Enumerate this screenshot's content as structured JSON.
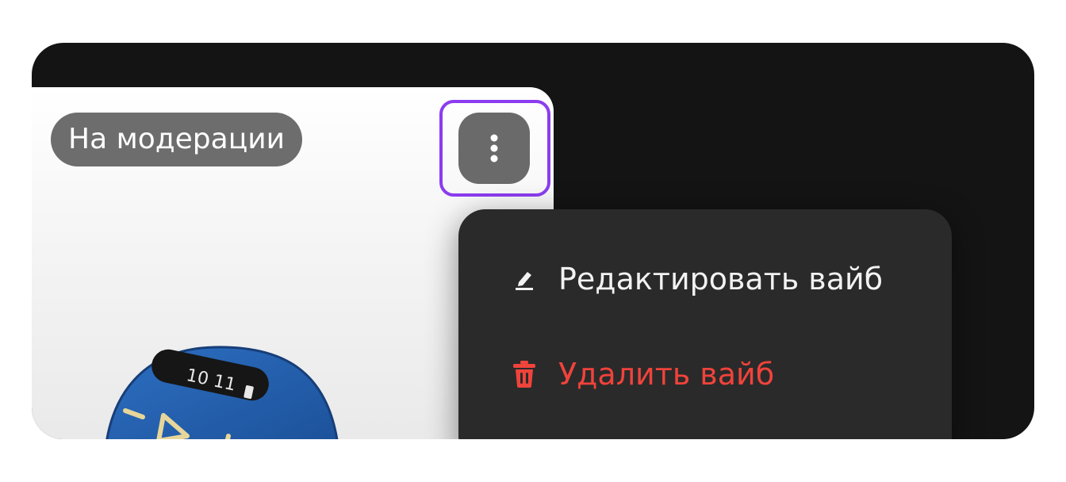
{
  "card": {
    "status_badge": "На модерации",
    "more_button_icon": "more-vertical-icon",
    "highlight_color": "#8b3cf0",
    "display_text": "10 11"
  },
  "menu": {
    "items": [
      {
        "label": "Редактировать вайб",
        "icon": "pencil-icon",
        "color": "#f2f2f2"
      },
      {
        "label": "Удалить вайб",
        "icon": "trash-icon",
        "color": "#f0433b"
      }
    ]
  }
}
